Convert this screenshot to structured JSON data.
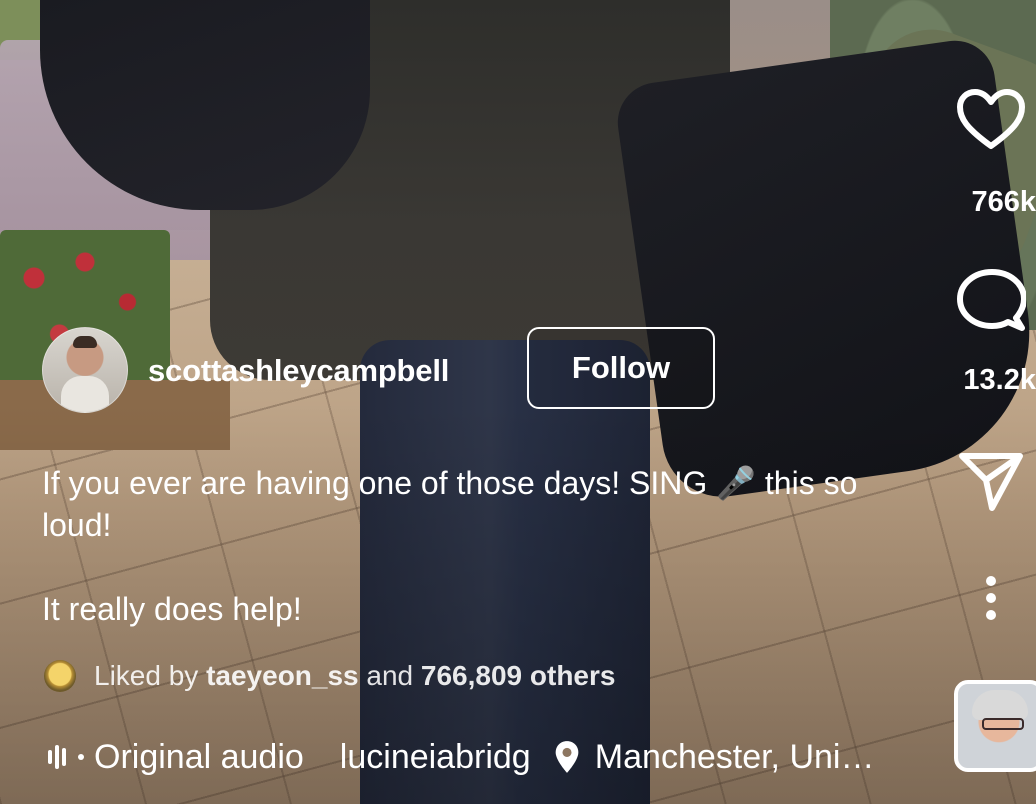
{
  "post": {
    "username": "scottashleycampbell",
    "follow_label": "Follow",
    "caption_line1": "If you ever are having one of those days! SING 🎤 this so loud!",
    "caption_line2": "It really does help!",
    "likes": {
      "prefix": "Liked by",
      "user": "taeyeon_ss",
      "joiner": "and",
      "others": "766,809 others"
    }
  },
  "audio": {
    "label": "Original audio",
    "credit": "lucineiabridg",
    "location": "Manchester, Uni…"
  },
  "actions": {
    "like_count": "766k",
    "comment_count": "13.2k"
  },
  "icons": [
    "heart-icon",
    "comment-icon",
    "share-icon",
    "more-icon",
    "location-pin-icon",
    "audio-bars-icon"
  ],
  "colors": {
    "text": "#ffffff"
  }
}
